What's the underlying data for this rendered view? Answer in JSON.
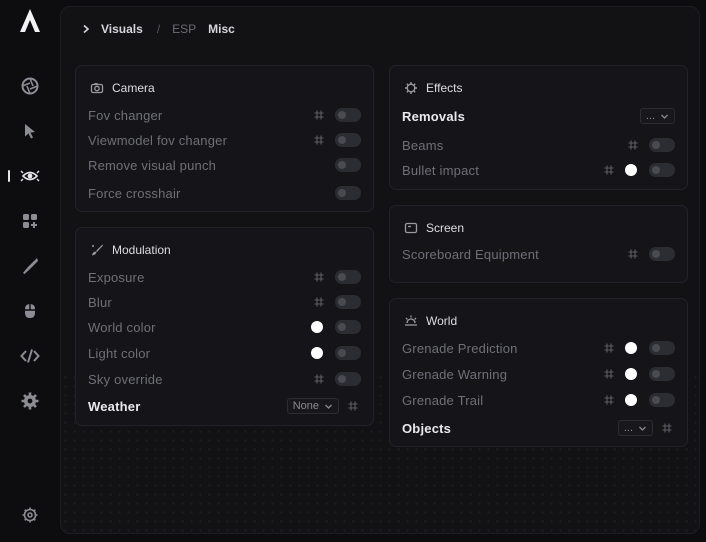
{
  "breadcrumb": {
    "current": "Visuals",
    "separator": "/",
    "tab_esp": "ESP",
    "tab_misc": "Misc"
  },
  "sidebar": {
    "items": [
      {
        "icon": "aperture-icon",
        "active": false
      },
      {
        "icon": "cursor-icon",
        "active": false
      },
      {
        "icon": "eye-burst-icon",
        "active": true
      },
      {
        "icon": "grid-plus-icon",
        "active": false
      },
      {
        "icon": "knife-icon",
        "active": false
      },
      {
        "icon": "mouse-icon",
        "active": false
      },
      {
        "icon": "code-icon",
        "active": false
      },
      {
        "icon": "gear-icon",
        "active": false
      }
    ],
    "footer_icon": "settings-icon"
  },
  "camera": {
    "title": "Camera",
    "rows": [
      {
        "label": "Fov changer",
        "hash": true,
        "dot": false,
        "toggle": false
      },
      {
        "label": "Viewmodel fov changer",
        "hash": true,
        "dot": false,
        "toggle": false
      },
      {
        "label": "Remove visual punch",
        "hash": false,
        "dot": false,
        "toggle": false
      },
      {
        "label": "Force crosshair",
        "hash": false,
        "dot": false,
        "toggle": false
      }
    ]
  },
  "modulation": {
    "title": "Modulation",
    "rows": [
      {
        "label": "Exposure",
        "hash": true,
        "dot": false,
        "toggle": false
      },
      {
        "label": "Blur",
        "hash": true,
        "dot": false,
        "toggle": false
      },
      {
        "label": "World color",
        "hash": false,
        "dot": true,
        "toggle": false
      },
      {
        "label": "Light color",
        "hash": false,
        "dot": true,
        "toggle": false
      },
      {
        "label": "Sky override",
        "hash": true,
        "dot": false,
        "toggle": false
      }
    ],
    "weather": {
      "label": "Weather",
      "value": "None"
    }
  },
  "effects": {
    "title": "Effects",
    "removals": {
      "label": "Removals",
      "value": "..."
    },
    "rows": [
      {
        "label": "Beams",
        "hash": true,
        "dot": false,
        "toggle": false
      },
      {
        "label": "Bullet impact",
        "hash": true,
        "dot": true,
        "toggle": false
      }
    ]
  },
  "screen": {
    "title": "Screen",
    "rows": [
      {
        "label": "Scoreboard Equipment",
        "hash": true,
        "dot": false,
        "toggle": false
      }
    ]
  },
  "world": {
    "title": "World",
    "rows": [
      {
        "label": "Grenade Prediction",
        "hash": true,
        "dot": true,
        "toggle": false
      },
      {
        "label": "Grenade Warning",
        "hash": true,
        "dot": true,
        "toggle": false
      },
      {
        "label": "Grenade Trail",
        "hash": true,
        "dot": true,
        "toggle": false
      }
    ],
    "objects": {
      "label": "Objects",
      "value": "..."
    }
  },
  "colors": {
    "background": "#0d0d10",
    "panel": "#151519",
    "toggle_off": "#2c2c33",
    "accent_dot": "#ffffff"
  }
}
